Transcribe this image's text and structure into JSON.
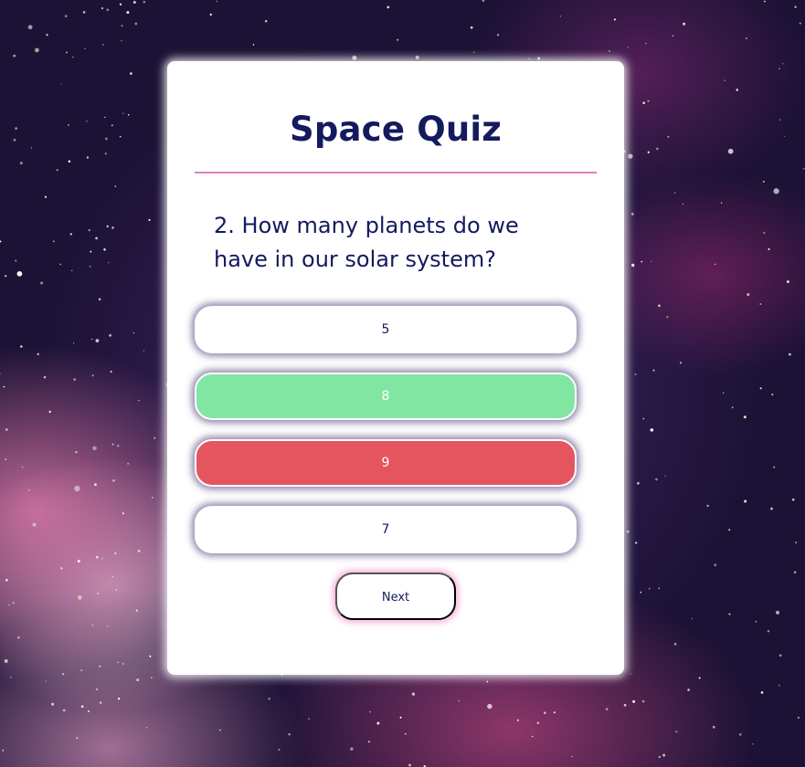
{
  "quiz": {
    "title": "Space Quiz",
    "question": "2. How many planets do we have in our solar system?",
    "answers": [
      {
        "label": "5",
        "state": "default"
      },
      {
        "label": "8",
        "state": "correct"
      },
      {
        "label": "9",
        "state": "wrong"
      },
      {
        "label": "7",
        "state": "default"
      }
    ],
    "next_label": "Next"
  },
  "colors": {
    "title_text": "#141a5e",
    "divider": "#e07fba",
    "correct": "#82e6a3",
    "wrong": "#e45560",
    "card_bg": "#ffffff"
  },
  "background": {
    "description_icon": "starfield-nebula"
  }
}
